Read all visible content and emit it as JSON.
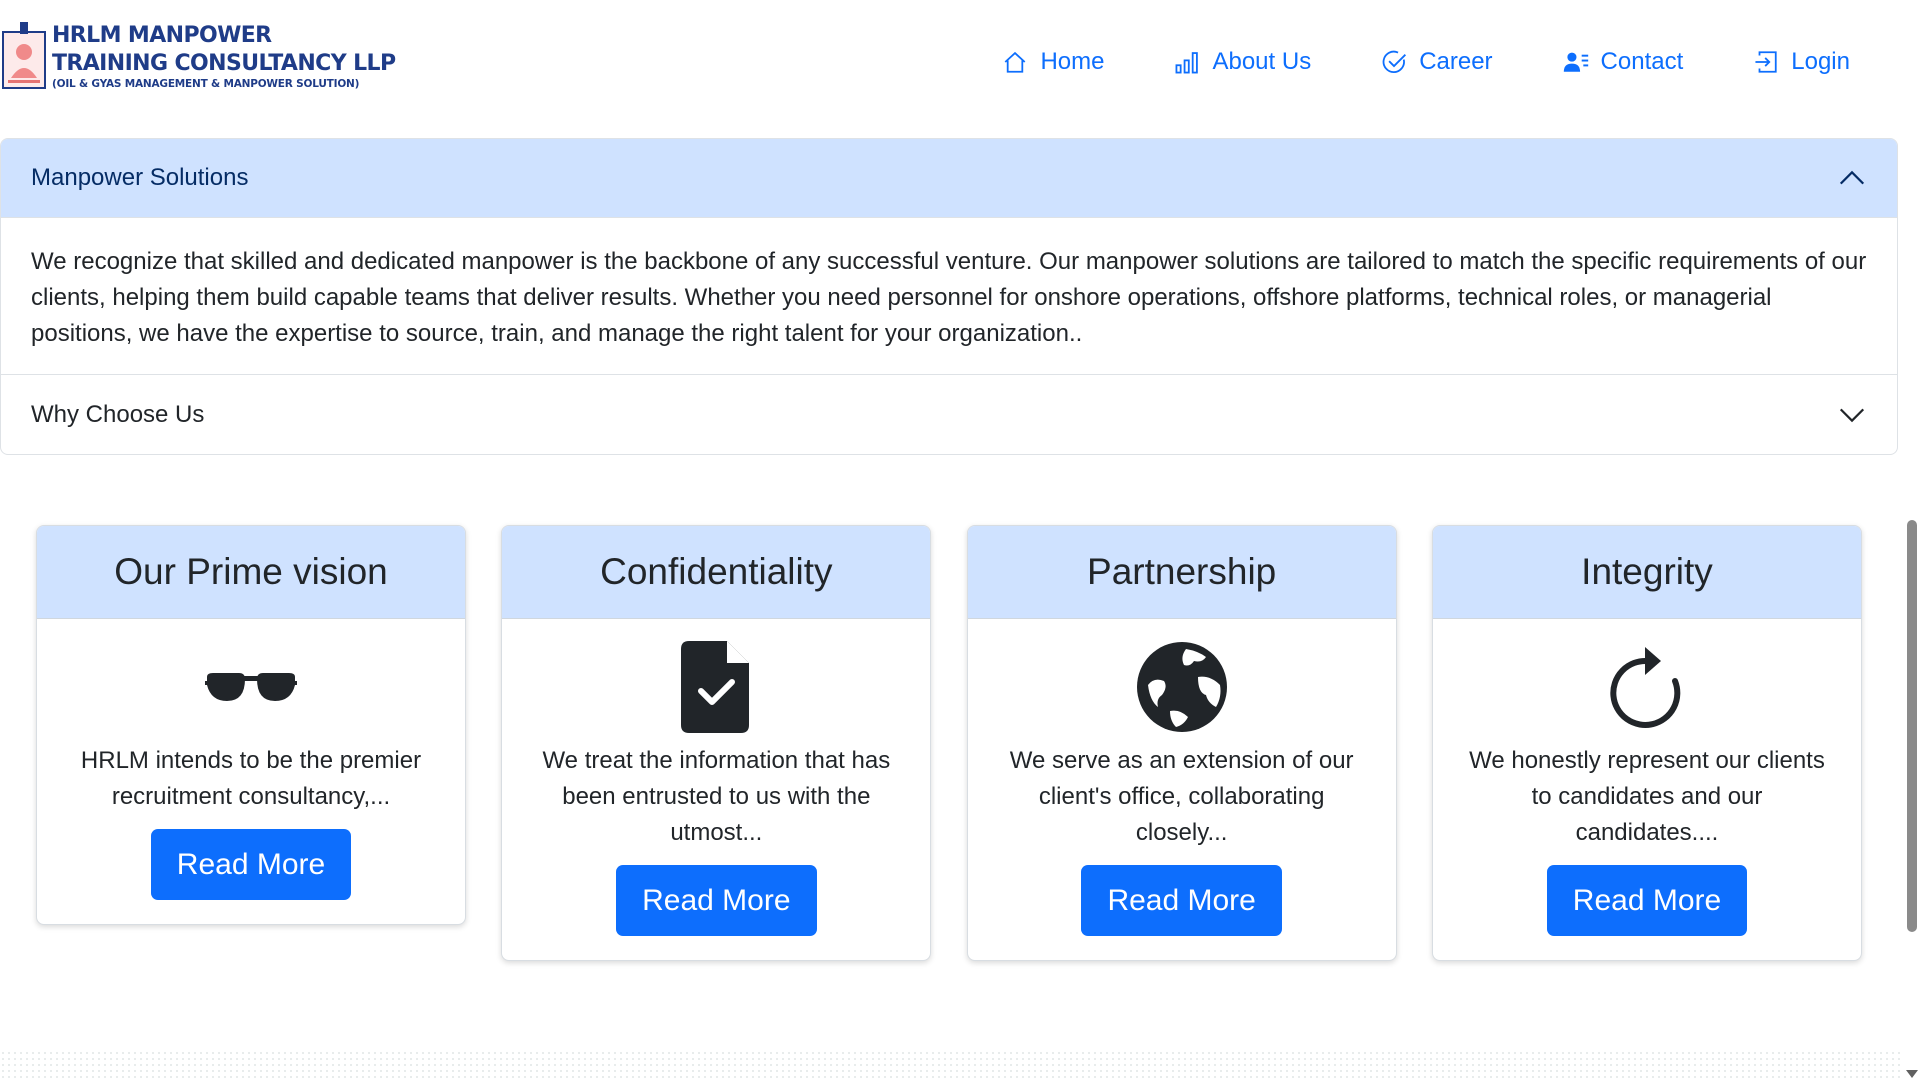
{
  "header": {
    "brand": {
      "line1": "HRLM MANPOWER",
      "line2": "TRAINING CONSULTANCY LLP",
      "line3": "(OIL & GYAS MANAGEMENT & MANPOWER SOLUTION)"
    },
    "nav": [
      {
        "label": "Home",
        "icon": "home-icon"
      },
      {
        "label": "About Us",
        "icon": "bar-chart-icon"
      },
      {
        "label": "Career",
        "icon": "check-circle-icon"
      },
      {
        "label": "Contact",
        "icon": "person-lines-icon"
      },
      {
        "label": "Login",
        "icon": "box-arrow-in-icon"
      }
    ]
  },
  "accordion": {
    "items": [
      {
        "title": "Manpower Solutions",
        "expanded": true,
        "body": "We recognize that skilled and dedicated manpower is the backbone of any successful venture. Our manpower solutions are tailored to match the specific requirements of our clients, helping them build capable teams that deliver results. Whether you need personnel for onshore operations, offshore platforms, technical roles, or managerial positions, we have the expertise to source, train, and manage the right talent for your organization.."
      },
      {
        "title": "Why Choose Us",
        "expanded": false
      }
    ]
  },
  "cards": [
    {
      "title": "Our Prime vision",
      "icon": "sunglasses-icon",
      "text": "HRLM intends to be the premier recruitment consultancy,...",
      "button": "Read More"
    },
    {
      "title": "Confidentiality",
      "icon": "file-check-icon",
      "text": "We treat the information that has been entrusted to us with the utmost...",
      "button": "Read More"
    },
    {
      "title": "Partnership",
      "icon": "globe-icon",
      "text": "We serve as an extension of our client's office, collaborating closely...",
      "button": "Read More"
    },
    {
      "title": "Integrity",
      "icon": "arrow-clockwise-icon",
      "text": "We honestly represent our clients to candidates and our candidates....",
      "button": "Read More"
    }
  ],
  "colors": {
    "primary": "#0d6efd",
    "brand": "#1f3c88",
    "accordion_active_bg": "#cfe2ff",
    "card_header_bg": "#cfe2ff"
  }
}
